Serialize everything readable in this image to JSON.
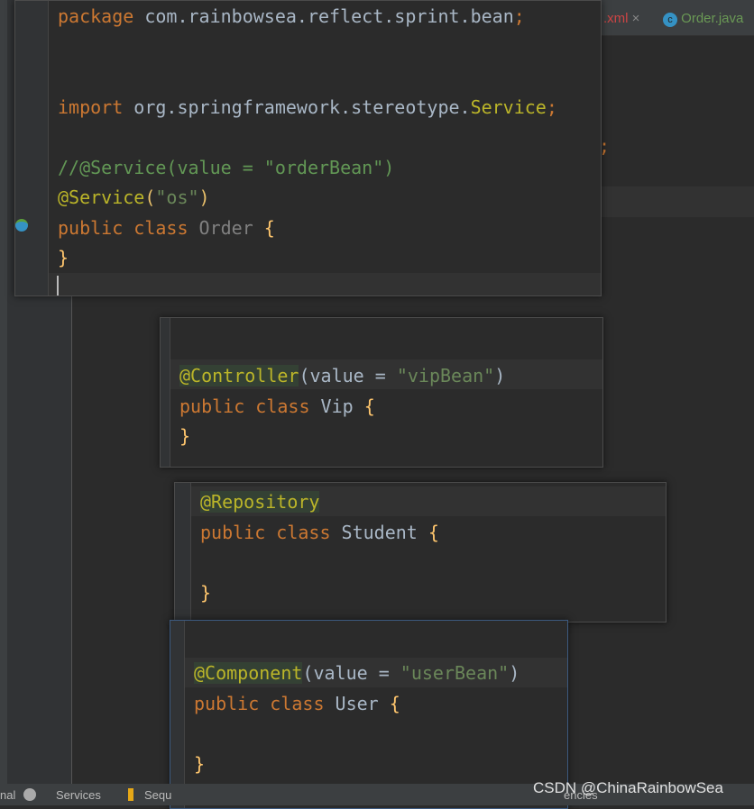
{
  "tabs": [
    {
      "label": ".xml",
      "close": "×",
      "icon": "xml-file-icon"
    },
    {
      "label": "Order.java",
      "icon": "class-icon",
      "icon_glyph": "c"
    }
  ],
  "snippets": {
    "order": {
      "package_kw": "package",
      "package_name": " com.rainbowsea.reflect.sprint.bean",
      "semi": ";",
      "import_kw": "import",
      "import_path": " org.springframework.stereotype.",
      "import_cls": "Service",
      "comment": "//@Service(value = \"orderBean\")",
      "ann": "@Service",
      "paren_open": "(",
      "str": "\"os\"",
      "paren_close": ")",
      "public": "public",
      "class": " class ",
      "name": "Order",
      "brace_open": " {",
      "brace_close": "}"
    },
    "vip": {
      "ann": "@Controller",
      "args_open": "(value = ",
      "str": "\"vipBean\"",
      "args_close": ")",
      "public": "public",
      "class": " class ",
      "name": "Vip",
      "brace_open": " {",
      "brace_close": "}"
    },
    "student": {
      "ann": "@Repository",
      "public": "public",
      "class": " class ",
      "name": "Student",
      "brace_open": " {",
      "brace_close": "}"
    },
    "user": {
      "ann": "@Component",
      "args_open": "(value = ",
      "str": "\"userBean\"",
      "args_close": ")",
      "public": "public",
      "class": " class ",
      "name": "User",
      "brace_open": " {",
      "brace_close": "}"
    }
  },
  "status": {
    "terminal": "nal",
    "services": "Services",
    "sequence": "Sequ",
    "dependencies": "encies"
  },
  "watermark": "CSDN @ChinaRainbowSea"
}
